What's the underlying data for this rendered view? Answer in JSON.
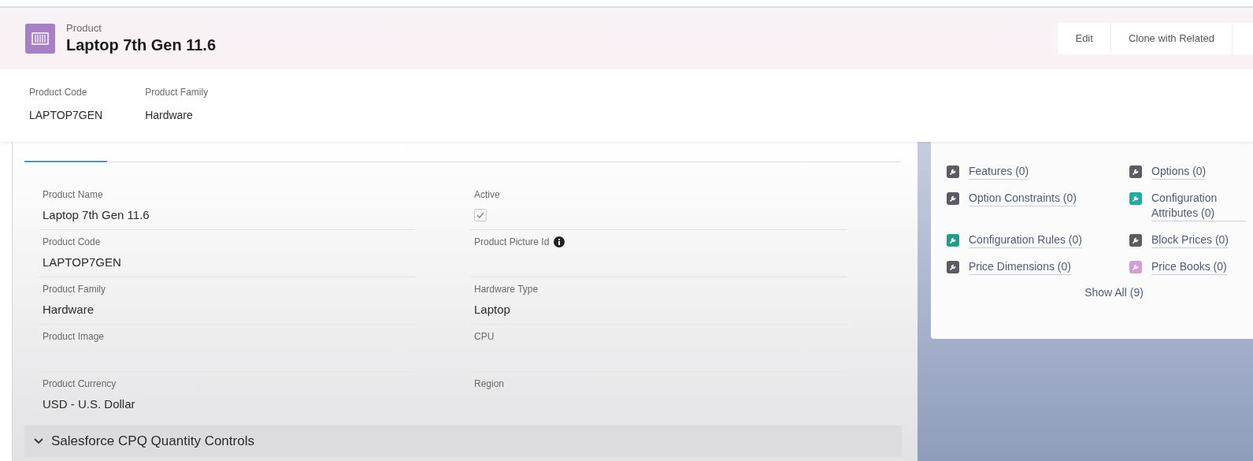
{
  "header": {
    "object_type": "Product",
    "title": "Laptop 7th Gen 11.6",
    "actions": [
      "Edit",
      "Clone with Related"
    ]
  },
  "highlights": [
    {
      "label": "Product Code",
      "value": "LAPTOP7GEN"
    },
    {
      "label": "Product Family",
      "value": "Hardware"
    }
  ],
  "fields": [
    {
      "kind": "text",
      "label": "Product Name",
      "value": "Laptop 7th Gen 11.6"
    },
    {
      "kind": "checkbox",
      "label": "Active",
      "checked": true
    },
    {
      "kind": "text",
      "label": "Product Code",
      "value": "LAPTOP7GEN"
    },
    {
      "kind": "text",
      "label": "Product Picture Id",
      "info": true
    },
    {
      "kind": "text",
      "label": "Product Family",
      "value": "Hardware"
    },
    {
      "kind": "text",
      "label": "Hardware Type",
      "value": "Laptop"
    },
    {
      "kind": "text",
      "label": "Product Image"
    },
    {
      "kind": "text",
      "label": "CPU"
    },
    {
      "kind": "text",
      "label": "Product Currency",
      "value": "USD - U.S. Dollar"
    },
    {
      "kind": "text",
      "label": "Region"
    }
  ],
  "section": {
    "title": "Salesforce CPQ Quantity Controls",
    "expanded": true
  },
  "quick_links": {
    "links": [
      {
        "label": "Features (0)",
        "color": "#5b5b66"
      },
      {
        "label": "Options (0)",
        "color": "#5b5b66"
      },
      {
        "label": "Option Constraints (0)",
        "color": "#5b5b66"
      },
      {
        "label": "Configuration Attributes (0)",
        "color": "#22aaa0"
      },
      {
        "label": "Configuration Rules (0)",
        "color": "#1e9e8c"
      },
      {
        "label": "Block Prices (0)",
        "color": "#5b5b66"
      },
      {
        "label": "Price Dimensions (0)",
        "color": "#5b5b66"
      },
      {
        "label": "Price Books (0)",
        "color": "#d59cd8"
      }
    ],
    "show_all": "Show All (9)"
  }
}
